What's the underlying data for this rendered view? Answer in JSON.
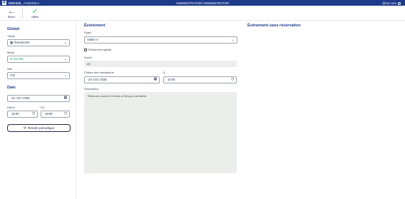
{
  "topbar": {
    "logo": "R",
    "brand_bold": "ORION_",
    "brand_light": "AGENDA",
    "center_title": "ADMINISTRATOR ADMINISTRATOR",
    "user_email": "@xxl.com"
  },
  "toolbar": {
    "back_label": "Retour",
    "save_label": "Valider"
  },
  "global": {
    "title": "Global",
    "tache_label": "Tâche",
    "tache_value": "Événement",
    "mode_label": "Mode",
    "mode_value": "Sur site",
    "site_label": "Site",
    "site_value": "COI"
  },
  "date": {
    "title": "Date",
    "date_value": "24 / 03 / 2026",
    "debut_label": "Début",
    "debut_value": "16:00",
    "fin_label": "Fin",
    "fin_value": "19:00",
    "periodic_button": "Rendre périodique"
  },
  "event": {
    "title": "Événement",
    "sujet_label": "Sujet",
    "sujet_required": "*",
    "sujet_value": "Atelier X",
    "global_checkbox_label": "Événement global",
    "duree_label": "Durée",
    "duree_value": "All",
    "cloture_label": "Clôture des inscriptions",
    "cloture_date": "24 / 03 / 2026",
    "a_label": "À",
    "a_time": "16:00",
    "description_label": "Description",
    "description_value": "Retrouvez-nous le 24 mars à 16h pour cet atelier"
  },
  "right": {
    "title": "Événement sans réservation"
  },
  "colors": {
    "topbar": "#1e3a8a",
    "accent": "#1f3a8a",
    "check": "#22c55e",
    "readonly_bg": "#eceeea"
  }
}
